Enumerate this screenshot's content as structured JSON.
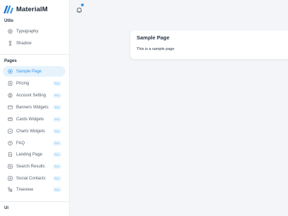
{
  "brand": {
    "name": "MaterialM",
    "logo": "materialm-logo",
    "accent": "#3797e6"
  },
  "sidebar": {
    "sections": [
      {
        "title": "Utils"
      },
      {
        "title": "Pages"
      },
      {
        "title": "Ui"
      }
    ],
    "utils_items": [
      {
        "label": "Typography",
        "icon": "typography-icon"
      },
      {
        "label": "Shadow",
        "icon": "shadow-icon"
      }
    ],
    "pages_items": [
      {
        "label": "Sample Page",
        "icon": "target-icon",
        "active": true
      },
      {
        "label": "Pricing",
        "icon": "dollar-icon",
        "badge": "Pro"
      },
      {
        "label": "Account Setting",
        "icon": "account-settings-icon",
        "badge": "Pro"
      },
      {
        "label": "Banners Widgets",
        "icon": "banner-icon",
        "badge": "Pro"
      },
      {
        "label": "Cards Widgets",
        "icon": "cards-icon",
        "badge": "Pro"
      },
      {
        "label": "Charts Widgets",
        "icon": "chart-icon",
        "badge": "Pro"
      },
      {
        "label": "FAQ",
        "icon": "help-icon",
        "badge": "Pro"
      },
      {
        "label": "Landing Page",
        "icon": "document-icon",
        "badge": "Pro"
      },
      {
        "label": "Search Results",
        "icon": "search-icon",
        "badge": "Pro"
      },
      {
        "label": "Social Contacts",
        "icon": "contacts-icon",
        "badge": "Pro"
      },
      {
        "label": "Treeview",
        "icon": "tree-icon",
        "badge": "Pro"
      }
    ]
  },
  "header": {
    "notification_icon": "bell-icon"
  },
  "main": {
    "card_title": "Sample Page",
    "card_text": "This is a sample page"
  }
}
